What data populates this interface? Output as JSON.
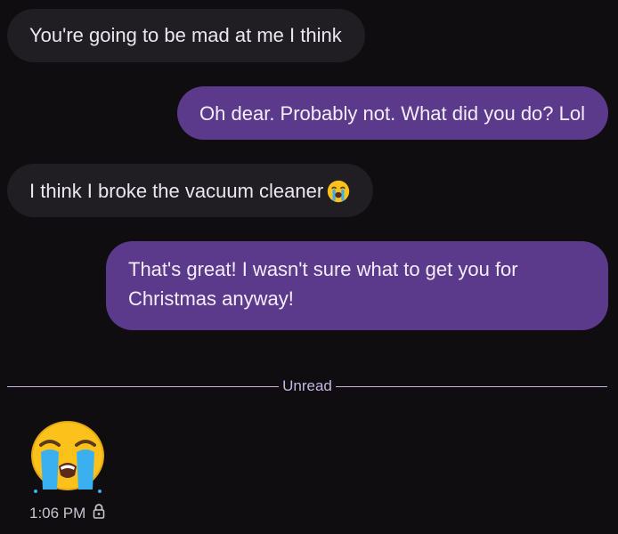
{
  "messages": [
    {
      "direction": "incoming",
      "text": "You're going to be mad at me I think"
    },
    {
      "direction": "outgoing",
      "text": "Oh dear. Probably not. What did you do? Lol"
    },
    {
      "direction": "incoming",
      "text": "I think I broke the vacuum cleaner",
      "trailing_emoji": "loudly-crying-face"
    },
    {
      "direction": "outgoing",
      "text": "That's great! I wasn't sure what to get you for Christmas anyway!"
    }
  ],
  "divider": {
    "label": "Unread"
  },
  "last_message": {
    "emoji": "loudly-crying-face",
    "time": "1:06 PM",
    "status_icon": "lock-icon"
  },
  "colors": {
    "background": "#0f0d10",
    "incoming_bubble": "#211e23",
    "outgoing_bubble": "#5b3a8b",
    "divider": "#c9b3e6"
  }
}
